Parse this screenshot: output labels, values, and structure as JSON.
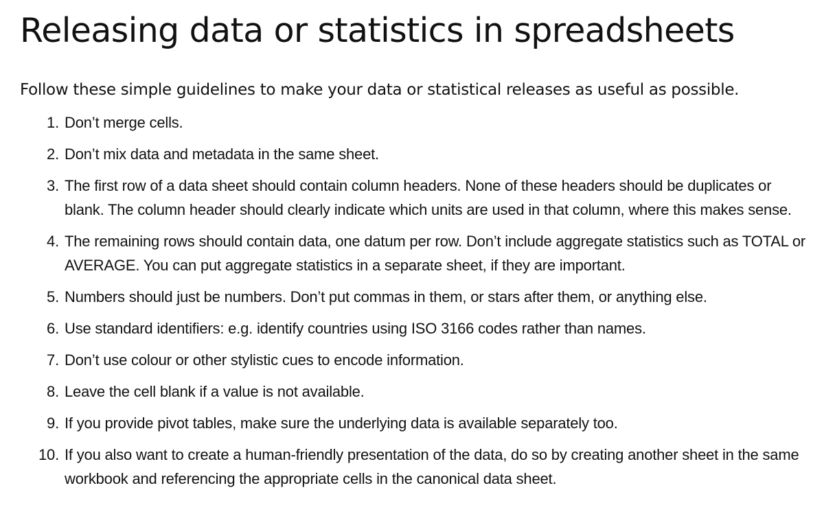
{
  "document": {
    "title": "Releasing data or statistics in spreadsheets",
    "intro": "Follow these simple guidelines to make your data or statistical releases as useful as possible.",
    "rules": [
      {
        "number": "1.",
        "text": "Don’t merge cells."
      },
      {
        "number": "2.",
        "text": "Don’t mix data and metadata in the same sheet."
      },
      {
        "number": "3.",
        "text": "The first row of a data sheet should contain column headers. None of these headers should be duplicates or blank. The column header should clearly indicate which units are used in that column, where this makes sense."
      },
      {
        "number": "4.",
        "text": "The remaining rows should contain data, one datum per row. Don’t include aggregate statistics such as TOTAL or AVERAGE. You can put aggregate statistics in a separate sheet, if they are important."
      },
      {
        "number": "5.",
        "text": "Numbers should just be numbers. Don’t put commas in them, or stars after them, or anything else."
      },
      {
        "number": "6.",
        "text": "Use standard identifiers: e.g. identify countries using ISO 3166 codes rather than names."
      },
      {
        "number": "7.",
        "text": "Don’t use colour or other stylistic cues to encode information."
      },
      {
        "number": "8.",
        "text": "Leave the cell blank if a value is not available."
      },
      {
        "number": "9.",
        "text": "If you provide pivot tables, make sure the underlying data is available separately too."
      },
      {
        "number": "10.",
        "text": "If you also want to create a human-friendly presentation of the data, do so by creating another sheet in the same workbook and referencing the appropriate cells in the canonical data sheet."
      }
    ]
  }
}
